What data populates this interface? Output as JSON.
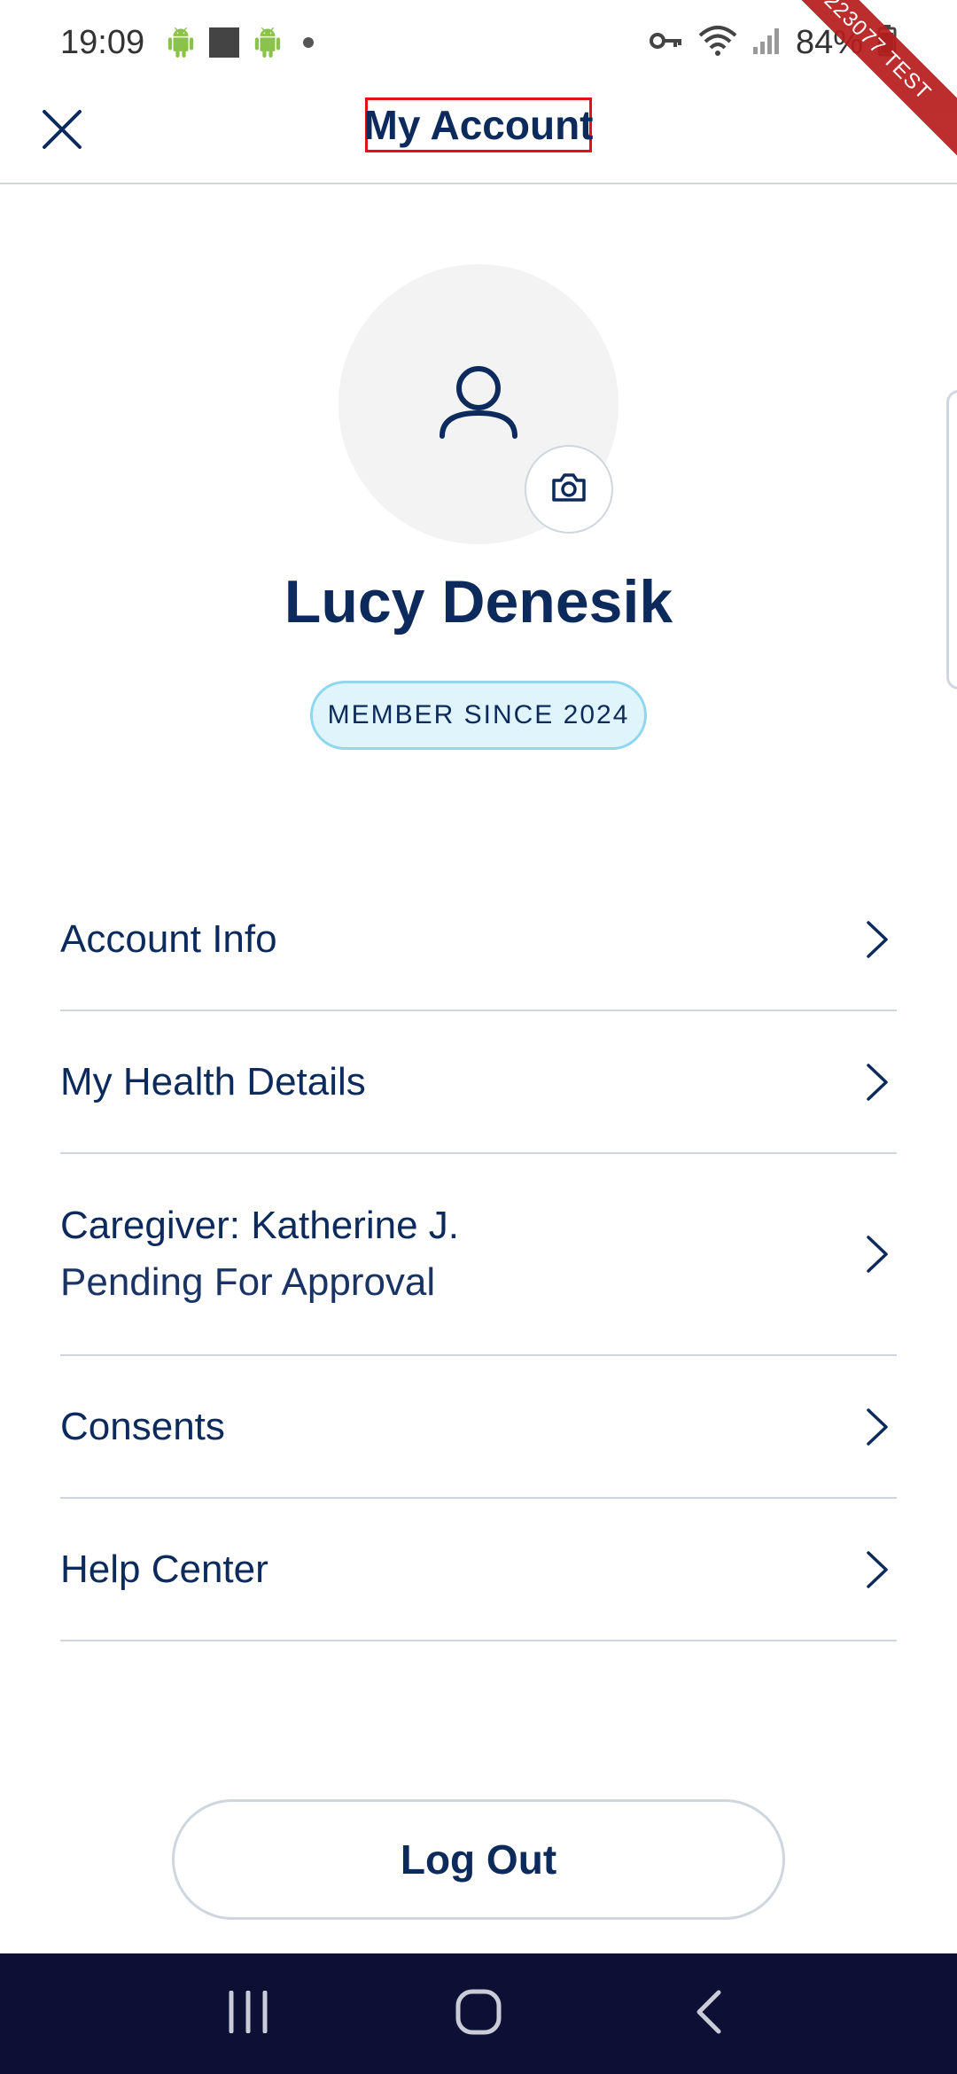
{
  "status_bar": {
    "time": "19:09",
    "battery": "84%",
    "icons": [
      "android-icon",
      "square-icon",
      "android-icon",
      "dot-icon",
      "key-icon",
      "wifi-icon",
      "signal-icon",
      "battery-icon"
    ]
  },
  "ribbon": {
    "text": "223077 TEST"
  },
  "header": {
    "title": "My Account",
    "close_icon": "close-icon"
  },
  "profile": {
    "name": "Lucy Denesik",
    "badge": "MEMBER SINCE 2024",
    "avatar_icon": "user-icon",
    "camera_icon": "camera-icon"
  },
  "menu": {
    "items": [
      {
        "label": "Account Info"
      },
      {
        "label": "My Health Details"
      },
      {
        "label": "Caregiver: Katherine J.",
        "sublabel": "Pending For Approval"
      },
      {
        "label": "Consents"
      },
      {
        "label": "Help Center"
      }
    ]
  },
  "logout": {
    "label": "Log Out"
  },
  "nav_bar": {
    "icons": [
      "recents-icon",
      "home-icon",
      "back-icon"
    ]
  },
  "colors": {
    "brand_navy": "#0d2a5c",
    "badge_bg": "#dff4fb",
    "badge_border": "#8fd6ef",
    "divider": "#cfd6e0",
    "nav_bg": "#0d0f35",
    "highlight": "#e3101b"
  }
}
